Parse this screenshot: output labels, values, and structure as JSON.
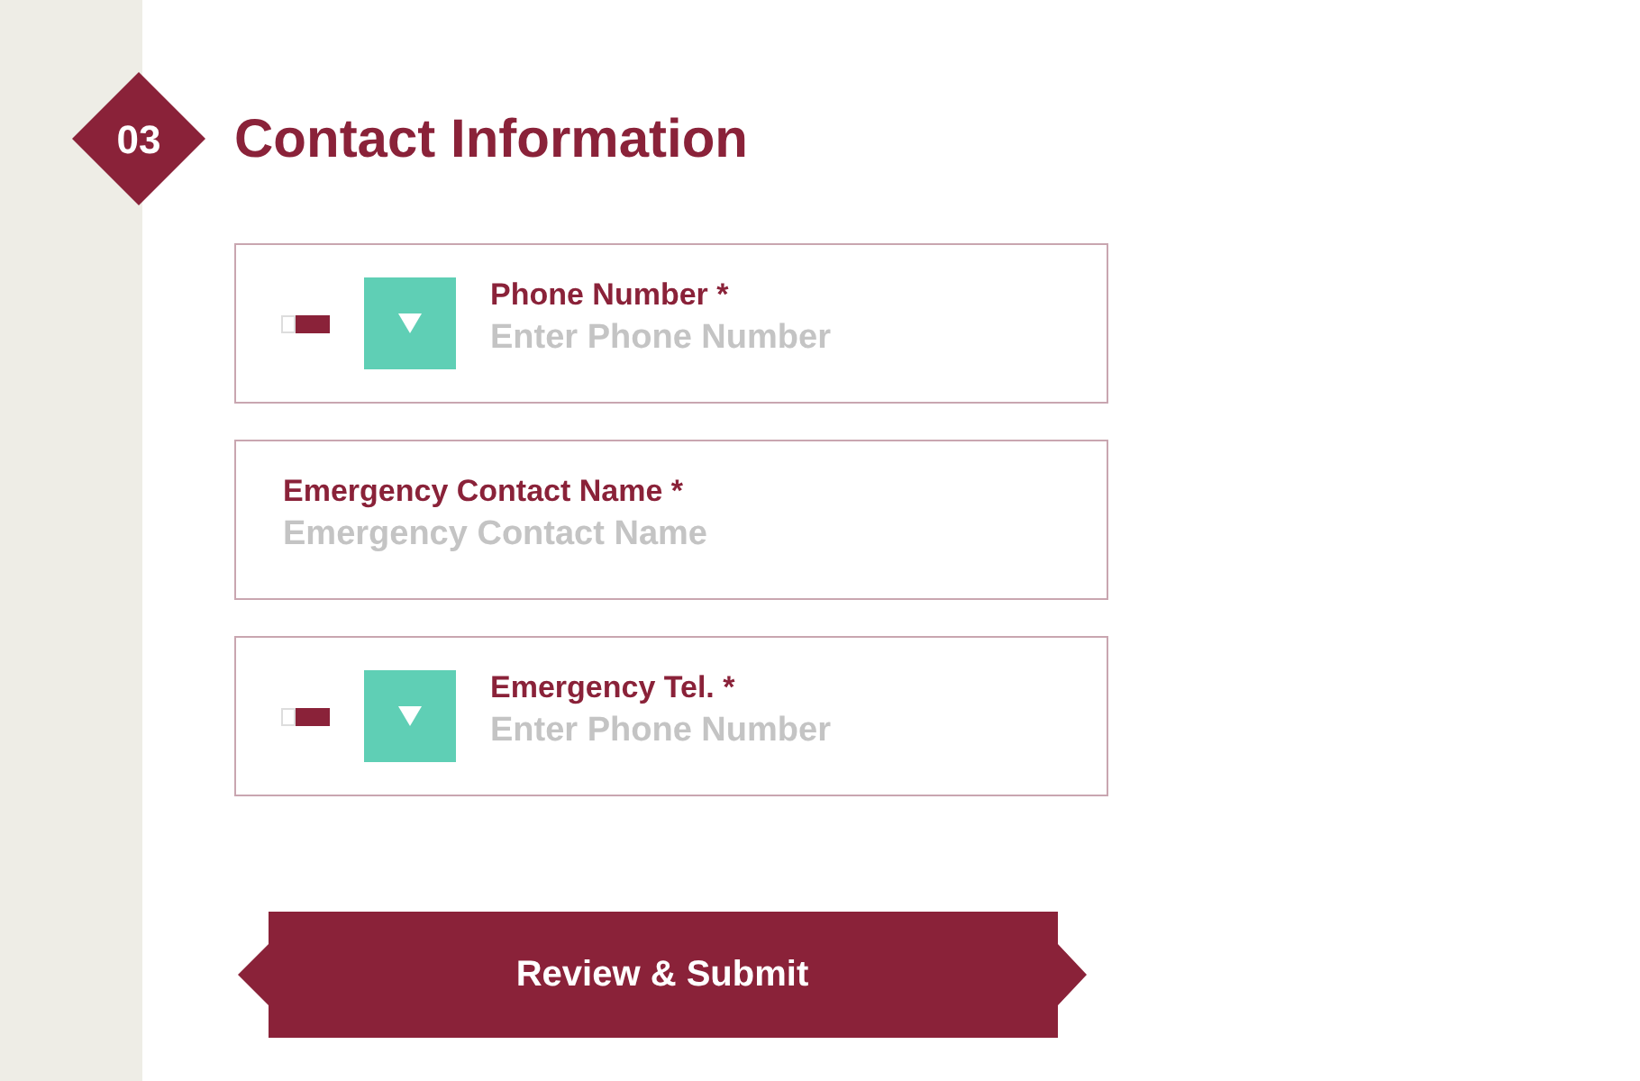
{
  "section": {
    "number": "03",
    "title": "Contact Information"
  },
  "fields": [
    {
      "kind": "phone",
      "label": "Phone Number *",
      "placeholder": "Enter Phone Number"
    },
    {
      "kind": "text",
      "label": "Emergency Contact Name *",
      "placeholder": "Emergency Contact Name"
    },
    {
      "kind": "phone",
      "label": "Emergency Tel. *",
      "placeholder": "Enter Phone Number"
    }
  ],
  "submit": "Review & Submit"
}
